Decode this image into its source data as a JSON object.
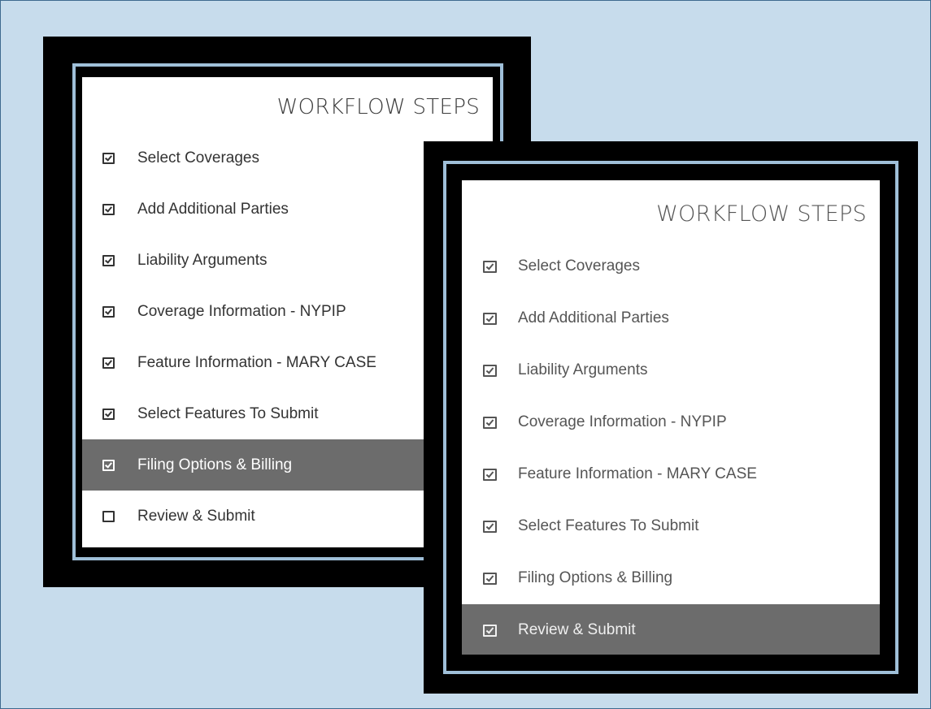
{
  "colors": {
    "background": "#c7dcec",
    "frame": "#000000",
    "frame_inner_border": "#9fbfd8",
    "panel": "#ffffff",
    "active_row": "#6c6c6c",
    "text": "#333333"
  },
  "left_panel": {
    "title": "WORKFLOW STEPS",
    "steps": [
      {
        "label": "Select Coverages",
        "checked": true,
        "icon": "checkbox-checked-icon"
      },
      {
        "label": "Add Additional Parties",
        "checked": true,
        "icon": "checkbox-checked-icon"
      },
      {
        "label": "Liability Arguments",
        "checked": true,
        "icon": "checkbox-checked-icon"
      },
      {
        "label": "Coverage Information - NYPIP",
        "checked": true,
        "icon": "checkbox-checked-icon"
      },
      {
        "label": "Feature Information - MARY CASE",
        "checked": true,
        "icon": "checkbox-checked-icon"
      },
      {
        "label": "Select Features To Submit",
        "checked": true,
        "icon": "checkbox-checked-icon"
      },
      {
        "label": "Filing Options & Billing",
        "checked": true,
        "active": true,
        "icon": "checkbox-checked-icon"
      },
      {
        "label": "Review & Submit",
        "checked": false,
        "icon": "checkbox-empty-icon"
      }
    ]
  },
  "right_panel": {
    "title": "WORKFLOW STEPS",
    "steps": [
      {
        "label": "Select Coverages",
        "checked": true,
        "icon": "checkbox-checked-icon"
      },
      {
        "label": "Add Additional Parties",
        "checked": true,
        "icon": "checkbox-checked-icon"
      },
      {
        "label": "Liability Arguments",
        "checked": true,
        "icon": "checkbox-checked-icon"
      },
      {
        "label": "Coverage Information - NYPIP",
        "checked": true,
        "icon": "checkbox-checked-icon"
      },
      {
        "label": "Feature Information - MARY CASE",
        "checked": true,
        "icon": "checkbox-checked-icon"
      },
      {
        "label": "Select Features To Submit",
        "checked": true,
        "icon": "checkbox-checked-icon"
      },
      {
        "label": "Filing Options & Billing",
        "checked": true,
        "icon": "checkbox-checked-icon"
      },
      {
        "label": "Review & Submit",
        "checked": true,
        "active": true,
        "icon": "checkbox-checked-icon"
      }
    ]
  }
}
